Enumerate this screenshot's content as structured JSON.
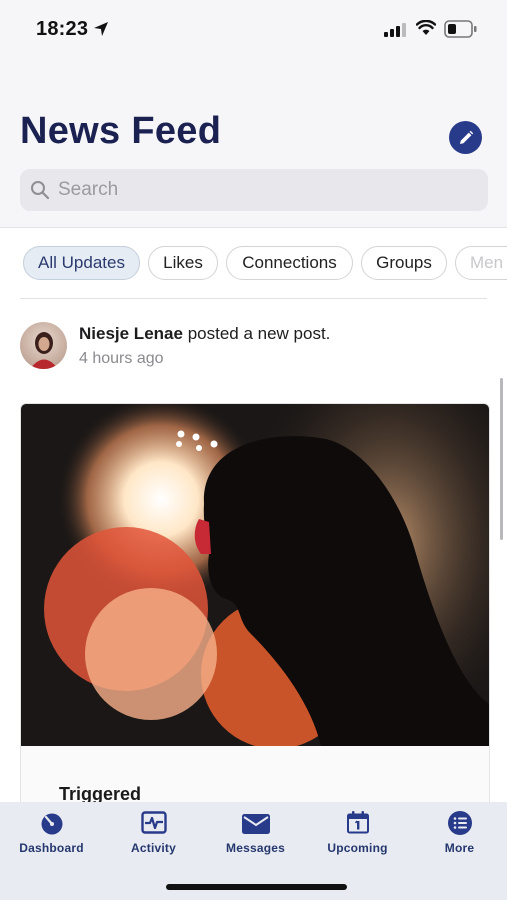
{
  "status_bar": {
    "time": "18:23",
    "icons": [
      "location-arrow-icon",
      "cellular-signal-icon",
      "wifi-icon",
      "battery-icon"
    ]
  },
  "header": {
    "title": "News Feed",
    "compose_icon": "pencil-icon"
  },
  "search": {
    "placeholder": "Search",
    "value": "",
    "icon": "search-icon"
  },
  "filters": [
    {
      "label": "All Updates",
      "active": true
    },
    {
      "label": "Likes",
      "active": false
    },
    {
      "label": "Connections",
      "active": false
    },
    {
      "label": "Groups",
      "active": false
    },
    {
      "label": "Men",
      "active": false
    }
  ],
  "post": {
    "author": "Niesje Lenae",
    "action": "posted a new post.",
    "time": "4 hours ago",
    "title": "Triggered"
  },
  "tab_bar": {
    "items": [
      {
        "label": "Dashboard",
        "icon": "dashboard-icon"
      },
      {
        "label": "Activity",
        "icon": "activity-icon"
      },
      {
        "label": "Messages",
        "icon": "envelope-icon"
      },
      {
        "label": "Upcoming",
        "icon": "calendar-icon"
      },
      {
        "label": "More",
        "icon": "list-icon"
      }
    ]
  },
  "colors": {
    "primary": "#283a8a",
    "title": "#1b2150",
    "tab_label": "#24376e",
    "active_chip_bg": "#e6ecf4"
  }
}
